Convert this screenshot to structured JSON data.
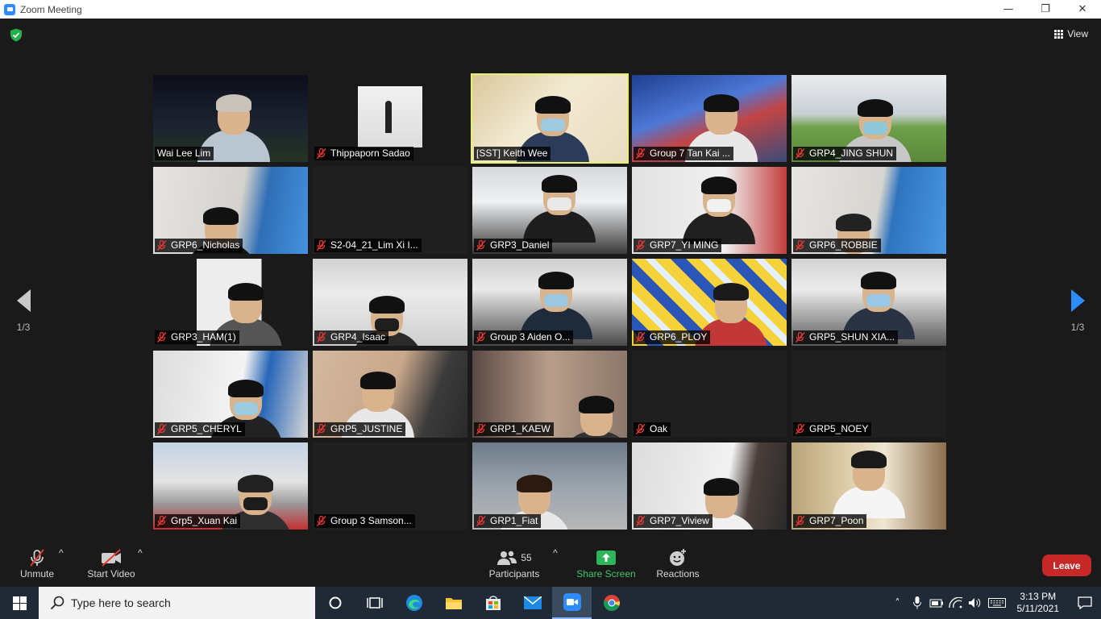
{
  "window": {
    "title": "Zoom Meeting",
    "minimize": "—",
    "restore": "❐",
    "close": "✕"
  },
  "header": {
    "view_label": "View"
  },
  "pagination": {
    "left": "1/3",
    "right": "1/3"
  },
  "participants": [
    {
      "name": "Wai Lee Lim",
      "muted": false,
      "active": false
    },
    {
      "name": "Thippaporn Sadao",
      "muted": true,
      "active": false
    },
    {
      "name": "[SST] Keith Wee",
      "muted": false,
      "active": true
    },
    {
      "name": "Group 7 Tan Kai ...",
      "muted": true,
      "active": false
    },
    {
      "name": "GRP4_JING SHUN",
      "muted": true,
      "active": false
    },
    {
      "name": "GRP6_Nicholas",
      "muted": true,
      "active": false
    },
    {
      "name": "S2-04_21_Lim Xi I...",
      "muted": true,
      "active": false
    },
    {
      "name": "GRP3_Daniel",
      "muted": true,
      "active": false
    },
    {
      "name": "GRP7_YI MING",
      "muted": true,
      "active": false
    },
    {
      "name": "GRP6_ROBBIE",
      "muted": true,
      "active": false
    },
    {
      "name": "GRP3_HAM(1)",
      "muted": true,
      "active": false
    },
    {
      "name": "GRP4_Isaac",
      "muted": true,
      "active": false
    },
    {
      "name": "Group 3 Aiden O...",
      "muted": true,
      "active": false
    },
    {
      "name": "GRP6_PLOY",
      "muted": true,
      "active": false
    },
    {
      "name": "GRP5_SHUN XIA...",
      "muted": true,
      "active": false
    },
    {
      "name": "GRP5_CHERYL",
      "muted": true,
      "active": false
    },
    {
      "name": "GRP5_JUSTINE",
      "muted": true,
      "active": false
    },
    {
      "name": "GRP1_KAEW",
      "muted": true,
      "active": false
    },
    {
      "name": "Oak",
      "muted": true,
      "active": false
    },
    {
      "name": "GRP5_NOEY",
      "muted": true,
      "active": false
    },
    {
      "name": "Grp5_Xuan Kai",
      "muted": true,
      "active": false
    },
    {
      "name": "Group 3 Samson...",
      "muted": true,
      "active": false
    },
    {
      "name": "GRP1_Fiat",
      "muted": true,
      "active": false
    },
    {
      "name": "GRP7_Viview",
      "muted": true,
      "active": false
    },
    {
      "name": "GRP7_Poon",
      "muted": true,
      "active": false
    }
  ],
  "toolbar": {
    "unmute": "Unmute",
    "start_video": "Start Video",
    "participants": "Participants",
    "participant_count": "55",
    "share_screen": "Share Screen",
    "reactions": "Reactions",
    "leave": "Leave"
  },
  "taskbar": {
    "search_placeholder": "Type here to search",
    "time": "3:13 PM",
    "date": "5/11/2021"
  },
  "colors": {
    "accent": "#2d8cff",
    "active_speaker": "#e7f06a",
    "leave": "#c62828",
    "share": "#3ec46d",
    "muted_mic": "#e53935"
  }
}
